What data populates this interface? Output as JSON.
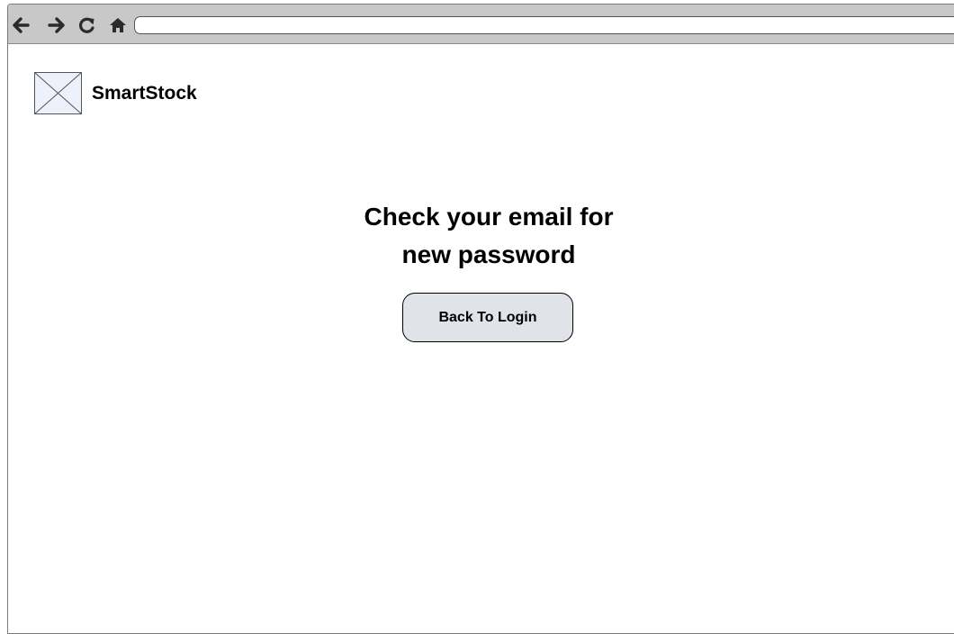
{
  "browser": {
    "icons": [
      "back-arrow-icon",
      "forward-arrow-icon",
      "reload-icon",
      "home-icon"
    ],
    "address_value": ""
  },
  "header": {
    "brand": "SmartStock",
    "logo_icon": "image-placeholder-icon"
  },
  "main": {
    "heading_line1": "Check your email for",
    "heading_line2": "new password",
    "back_button_label": "Back To Login"
  },
  "colors": {
    "toolbar": "#c8c8c8",
    "button_bg": "#e0e3e8",
    "logo_bg": "#eef0fb"
  }
}
